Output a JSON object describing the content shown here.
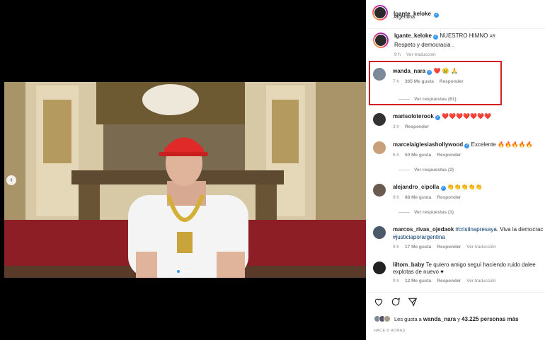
{
  "post_header": {
    "username": "lgante_keloke",
    "location": "Argentina"
  },
  "caption": {
    "username": "lgante_keloke",
    "text": "NUESTRO HIMNO",
    "flag": "AR",
    "line2": "Respeto y democracia .",
    "time": "9 h",
    "translate": "Ver traducción"
  },
  "comments": [
    {
      "username": "wanda_nara",
      "text": "❤️ 😢 🙏",
      "time": "7 h",
      "likes": "365 Me gusta",
      "reply": "Responder",
      "replies": "Ver respuestas (61)"
    },
    {
      "username": "marisoloterook",
      "text": "❤️❤️❤️❤️❤️❤️❤️",
      "time": "3 h",
      "likes": "",
      "reply": "Responder"
    },
    {
      "username": "marcelaiglesiashollywood",
      "text": "Excelente 🔥🔥🔥🔥🔥",
      "time": "6 h",
      "likes": "50 Me gusta",
      "reply": "Responder",
      "replies": "Ver respuestas (2)"
    },
    {
      "username": "alejandro_cipolla",
      "text": "👏👏👏👏👏",
      "time": "9 h",
      "likes": "88 Me gusta",
      "reply": "Responder",
      "replies": "Ver respuestas (1)"
    },
    {
      "username": "marcos_rivas_ojedaok",
      "tag": "#cristinapresaya",
      "text": ". Viva la democracia",
      "tag2": "#justiciaporargentina",
      "time": "9 h",
      "likes": "17 Me gusta",
      "reply": "Responder",
      "translate": "Ver traducción"
    },
    {
      "username": "liltom_baby",
      "text": "Te quiero amigo seguí haciendo ruido dalee explotas de nuevo ♥",
      "time": "9 h",
      "likes": "12 Me gusta",
      "reply": "Responder",
      "translate": "Ver traducción"
    }
  ],
  "footer": {
    "likes_prefix": "Les gusta a",
    "likes_user": "wanda_nara",
    "likes_suffix": "y",
    "likes_count": "43.225 personas más",
    "time": "HACE 8 HORAS"
  },
  "colors": {
    "accent": "#3897f0",
    "highlight": "#d21f26",
    "heart": "#ed4956"
  }
}
